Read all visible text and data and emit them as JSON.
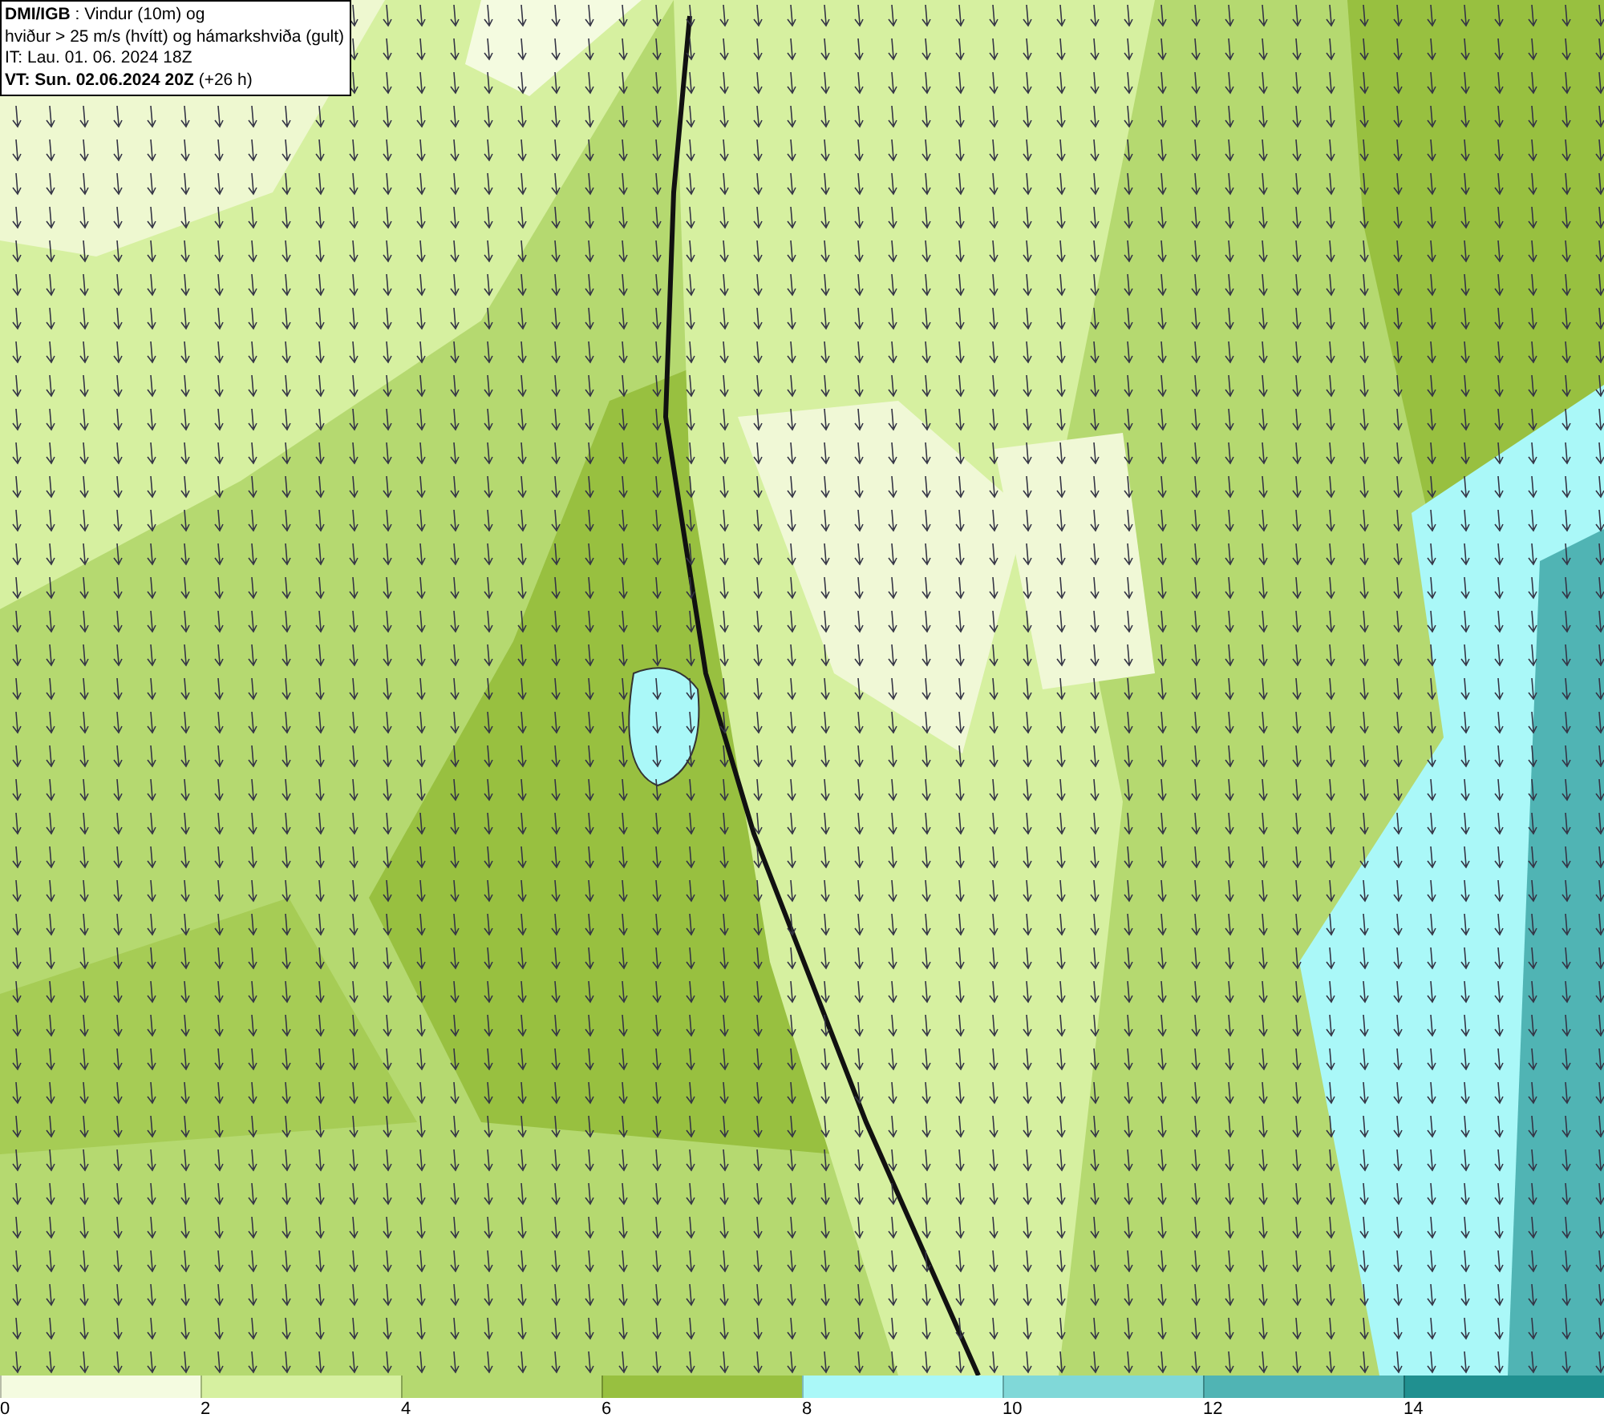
{
  "header": {
    "lines": [
      "**DMI/IGB** : Vindur (10m) og",
      "hviður > 25 m/s (hvítt) og hámarkshviða (gult)",
      "IT: Lau. 01. 06. 2024 18Z",
      "**VT: Sun. 02.06.2024 20Z** (+26 h)"
    ]
  },
  "legend": [
    {
      "label": "0",
      "color": "#f4fbe0"
    },
    {
      "label": "2",
      "color": "#d6f0a0"
    },
    {
      "label": "4",
      "color": "#b5d970"
    },
    {
      "label": "6",
      "color": "#98c040"
    },
    {
      "label": "8",
      "color": "#aaf8f8"
    },
    {
      "label": "10",
      "color": "#80d8d8"
    },
    {
      "label": "12",
      "color": "#50b4b4"
    },
    {
      "label": "14",
      "color": "#209090"
    }
  ]
}
